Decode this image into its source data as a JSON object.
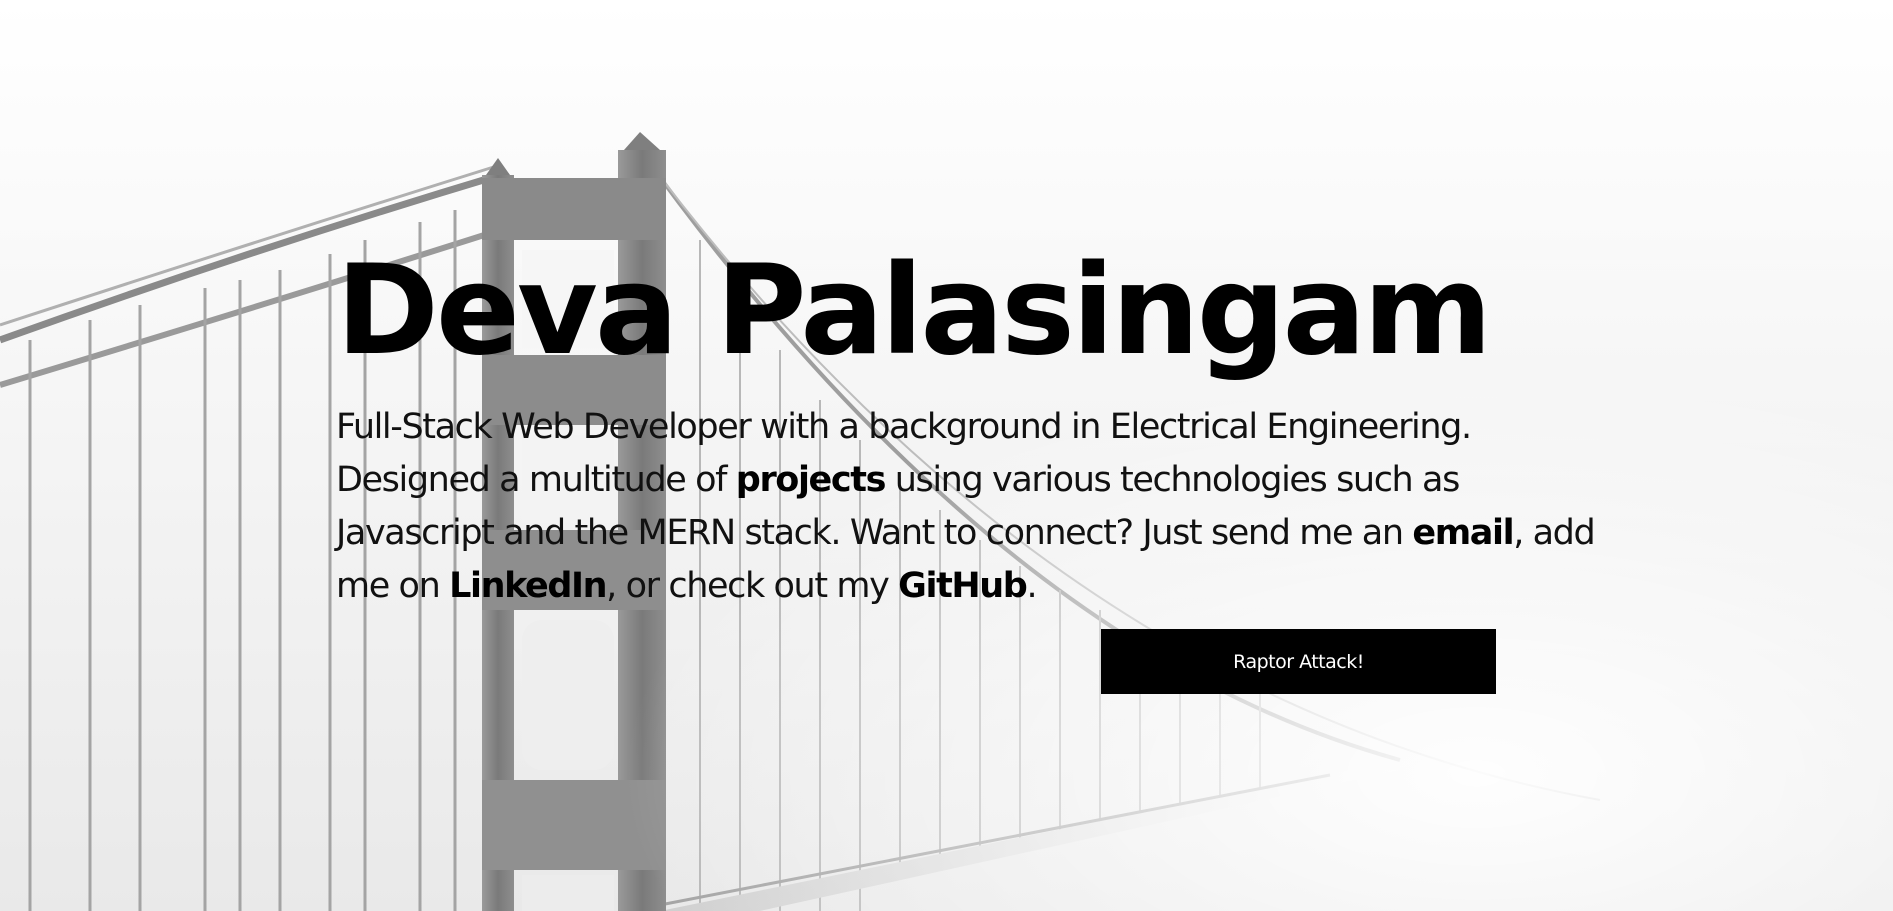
{
  "hero": {
    "name": "Deva Palasingam",
    "bio": {
      "part1": "Full-Stack Web Developer with a background in Electrical Engineering. Designed a multitude of ",
      "projects_link": "projects",
      "part2": " using various technologies such as Javascript and the MERN stack. Want to connect? Just send me an ",
      "email_link": "email",
      "part3": ", add me on ",
      "linkedin_link": "LinkedIn",
      "part4": ", or check out my ",
      "github_link": "GitHub",
      "part5": "."
    },
    "button_label": "Raptor Attack!"
  },
  "background": {
    "image": "foggy-suspension-bridge",
    "accent": "#000000",
    "text_color": "#111111"
  }
}
